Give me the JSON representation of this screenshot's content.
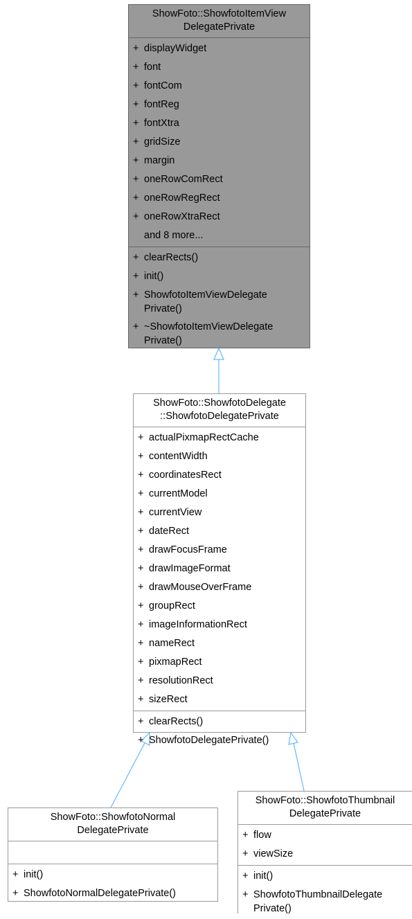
{
  "classes": {
    "base": {
      "title": [
        "ShowFoto::ShowfotoItemView",
        "DelegatePrivate"
      ],
      "attributes": [
        "displayWidget",
        "font",
        "fontCom",
        "fontReg",
        "fontXtra",
        "gridSize",
        "margin",
        "oneRowComRect",
        "oneRowRegRect",
        "oneRowXtraRect"
      ],
      "more": "and 8 more...",
      "methods": [
        [
          "clearRects()"
        ],
        [
          "init()"
        ],
        [
          "ShowfotoItemViewDelegate",
          "Private()"
        ],
        [
          "~ShowfotoItemViewDelegate",
          "Private()"
        ]
      ]
    },
    "delegate_private": {
      "title": [
        "ShowFoto::ShowfotoDelegate",
        "::ShowfotoDelegatePrivate"
      ],
      "attributes": [
        "actualPixmapRectCache",
        "contentWidth",
        "coordinatesRect",
        "currentModel",
        "currentView",
        "dateRect",
        "drawFocusFrame",
        "drawImageFormat",
        "drawMouseOverFrame",
        "groupRect",
        "imageInformationRect",
        "nameRect",
        "pixmapRect",
        "resolutionRect",
        "sizeRect"
      ],
      "methods": [
        [
          "clearRects()"
        ],
        [
          "ShowfotoDelegatePrivate()"
        ]
      ]
    },
    "normal": {
      "title": [
        "ShowFoto::ShowfotoNormal",
        "DelegatePrivate"
      ],
      "attributes": [],
      "methods": [
        [
          "init()"
        ],
        [
          "ShowfotoNormalDelegatePrivate()"
        ]
      ]
    },
    "thumbnail": {
      "title": [
        "ShowFoto::ShowfotoThumbnail",
        "DelegatePrivate"
      ],
      "attributes": [
        "flow",
        "viewSize"
      ],
      "methods": [
        [
          "init()"
        ],
        [
          "ShowfotoThumbnailDelegate",
          "Private()"
        ]
      ]
    }
  },
  "visibility_symbol": "+",
  "colors": {
    "edge": "#63b8ff",
    "base_fill": "#999999",
    "border": "#999999"
  }
}
